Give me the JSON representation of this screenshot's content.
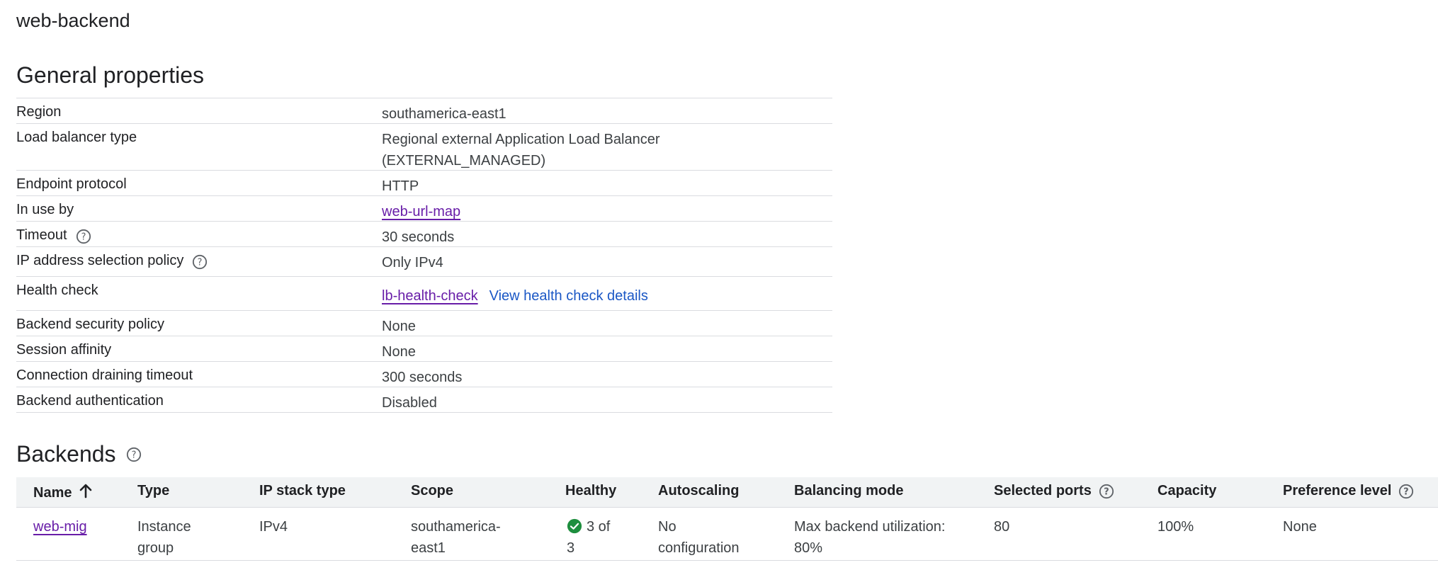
{
  "page": {
    "title": "web-backend"
  },
  "general": {
    "title": "General properties",
    "rows": [
      {
        "label": "Region",
        "value": "southamerica-east1"
      },
      {
        "label": "Load balancer type",
        "value_line1": "Regional external Application Load Balancer",
        "value_line2": "(EXTERNAL_MANAGED)"
      },
      {
        "label": "Endpoint protocol",
        "value": "HTTP"
      },
      {
        "label": "In use by",
        "link": "web-url-map"
      },
      {
        "label": "Timeout",
        "value": "30 seconds",
        "help_icon": "help-circle-icon"
      },
      {
        "label": "IP address selection policy",
        "value": "Only IPv4",
        "help_icon": "help-circle-icon"
      },
      {
        "label": "Health check",
        "link": "lb-health-check",
        "secondary_link": "View health check details"
      },
      {
        "label": "Backend security policy",
        "value": "None"
      },
      {
        "label": "Session affinity",
        "value": "None"
      },
      {
        "label": "Connection draining timeout",
        "value": "300 seconds"
      },
      {
        "label": "Backend authentication",
        "value": "Disabled"
      }
    ]
  },
  "backends": {
    "title": "Backends",
    "columns": [
      "Name",
      "Type",
      "IP stack type",
      "Scope",
      "Healthy",
      "Autoscaling",
      "Balancing mode",
      "Selected ports",
      "Capacity",
      "Preference level"
    ],
    "sort_column": "Name",
    "sort_direction": "ascending",
    "rows": [
      {
        "name": "web-mig",
        "type_line1": "Instance",
        "type_line2": "group",
        "ip_stack": "IPv4",
        "scope_line1": "southamerica-",
        "scope_line2": "east1",
        "healthy_line1": "3 of",
        "healthy_line2": "3",
        "autoscaling_line1": "No",
        "autoscaling_line2": "configuration",
        "balancing_line1": "Max backend utilization:",
        "balancing_line2": "80%",
        "ports": "80",
        "capacity": "100%",
        "preference": "None"
      }
    ]
  },
  "colors": {
    "link_visited": "#681da8",
    "link_blue": "#1a57c5",
    "healthy_green": "#1e8e3e",
    "border": "#dadce0",
    "header_bg": "#f1f3f4"
  }
}
